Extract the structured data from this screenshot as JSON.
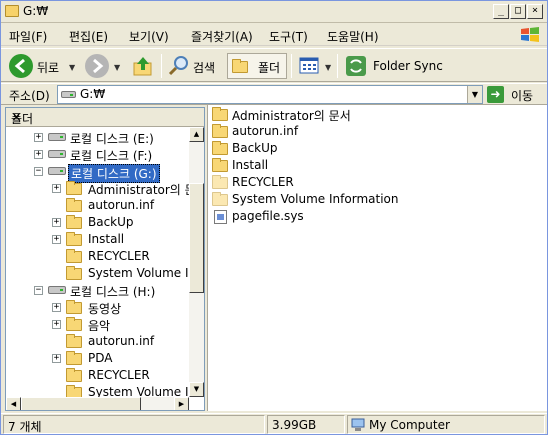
{
  "window": {
    "title": "G:₩"
  },
  "menu": {
    "items": [
      "파일(F)",
      "편집(E)",
      "보기(V)",
      "즐겨찾기(A)",
      "도구(T)",
      "도움말(H)"
    ]
  },
  "toolbar": {
    "back": "뒤로",
    "search": "검색",
    "folders": "폴더",
    "folder_sync": "Folder Sync"
  },
  "address": {
    "label": "주소(D)",
    "value": "G:₩",
    "go": "이동"
  },
  "tree": {
    "title": "폴더",
    "close": "×",
    "nodes": [
      {
        "label": "로컬 디스크 (E:)",
        "expander": "+"
      },
      {
        "label": "로컬 디스크 (F:)",
        "expander": "+"
      },
      {
        "label": "로컬 디스크 (G:)",
        "expander": "−",
        "selected": true
      },
      {
        "label": "Administrator의 문",
        "expander": "+"
      },
      {
        "label": "autorun.inf",
        "expander": ""
      },
      {
        "label": "BackUp",
        "expander": "+"
      },
      {
        "label": "Install",
        "expander": "+"
      },
      {
        "label": "RECYCLER",
        "expander": ""
      },
      {
        "label": "System Volume I",
        "expander": ""
      },
      {
        "label": "로컬 디스크 (H:)",
        "expander": "−"
      },
      {
        "label": "동영상",
        "expander": "+"
      },
      {
        "label": "음악",
        "expander": "+"
      },
      {
        "label": "autorun.inf",
        "expander": ""
      },
      {
        "label": "PDA",
        "expander": "+"
      },
      {
        "label": "RECYCLER",
        "expander": ""
      },
      {
        "label": "System Volume I",
        "expander": ""
      }
    ]
  },
  "files": [
    {
      "name": "Administrator의 문서",
      "kind": "folder"
    },
    {
      "name": "autorun.inf",
      "kind": "folder"
    },
    {
      "name": "BackUp",
      "kind": "folder"
    },
    {
      "name": "Install",
      "kind": "folder"
    },
    {
      "name": "RECYCLER",
      "kind": "hidden-folder"
    },
    {
      "name": "System Volume Information",
      "kind": "hidden-folder"
    },
    {
      "name": "pagefile.sys",
      "kind": "system-file"
    }
  ],
  "status": {
    "count": "7 개체",
    "size": "3.99GB",
    "location": "My Computer"
  }
}
